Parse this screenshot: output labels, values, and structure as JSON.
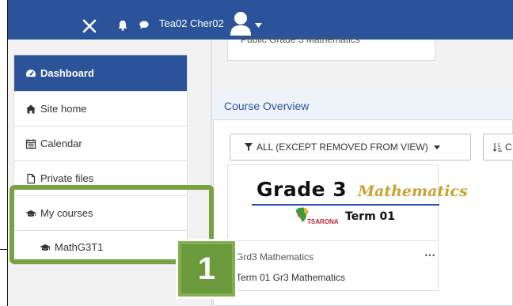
{
  "header": {
    "username": "Tea02 Cher02"
  },
  "sidebar": {
    "items": [
      {
        "label": "Dashboard",
        "icon": "tachometer-icon"
      },
      {
        "label": "Site home",
        "icon": "home-icon"
      },
      {
        "label": "Calendar",
        "icon": "calendar-icon"
      },
      {
        "label": "Private files",
        "icon": "file-icon"
      },
      {
        "label": "My courses",
        "icon": "graduation-cap-icon"
      },
      {
        "label": "MathG3T1",
        "icon": "graduation-cap-icon"
      }
    ]
  },
  "main": {
    "top_card_text": "Public Grade 3 Mathematics",
    "course_overview": {
      "title": "Course Overview",
      "filter_label": "ALL (EXCEPT REMOVED FROM VIEW)",
      "sort_label": "C"
    },
    "course": {
      "image": {
        "title": "Grade 3",
        "subtitle": "Mathematics",
        "brand": "TSARONA",
        "term": "Term 01"
      },
      "category": "Grd3 Mathematics",
      "name": "Term 01 Gr3 Mathematics",
      "menu": "⋯"
    }
  },
  "annotation": {
    "step_number": "1",
    "color": "#77a244"
  },
  "colors": {
    "navbar": "#2b5399",
    "accent": "#2b5399",
    "highlight": "#77a244"
  }
}
